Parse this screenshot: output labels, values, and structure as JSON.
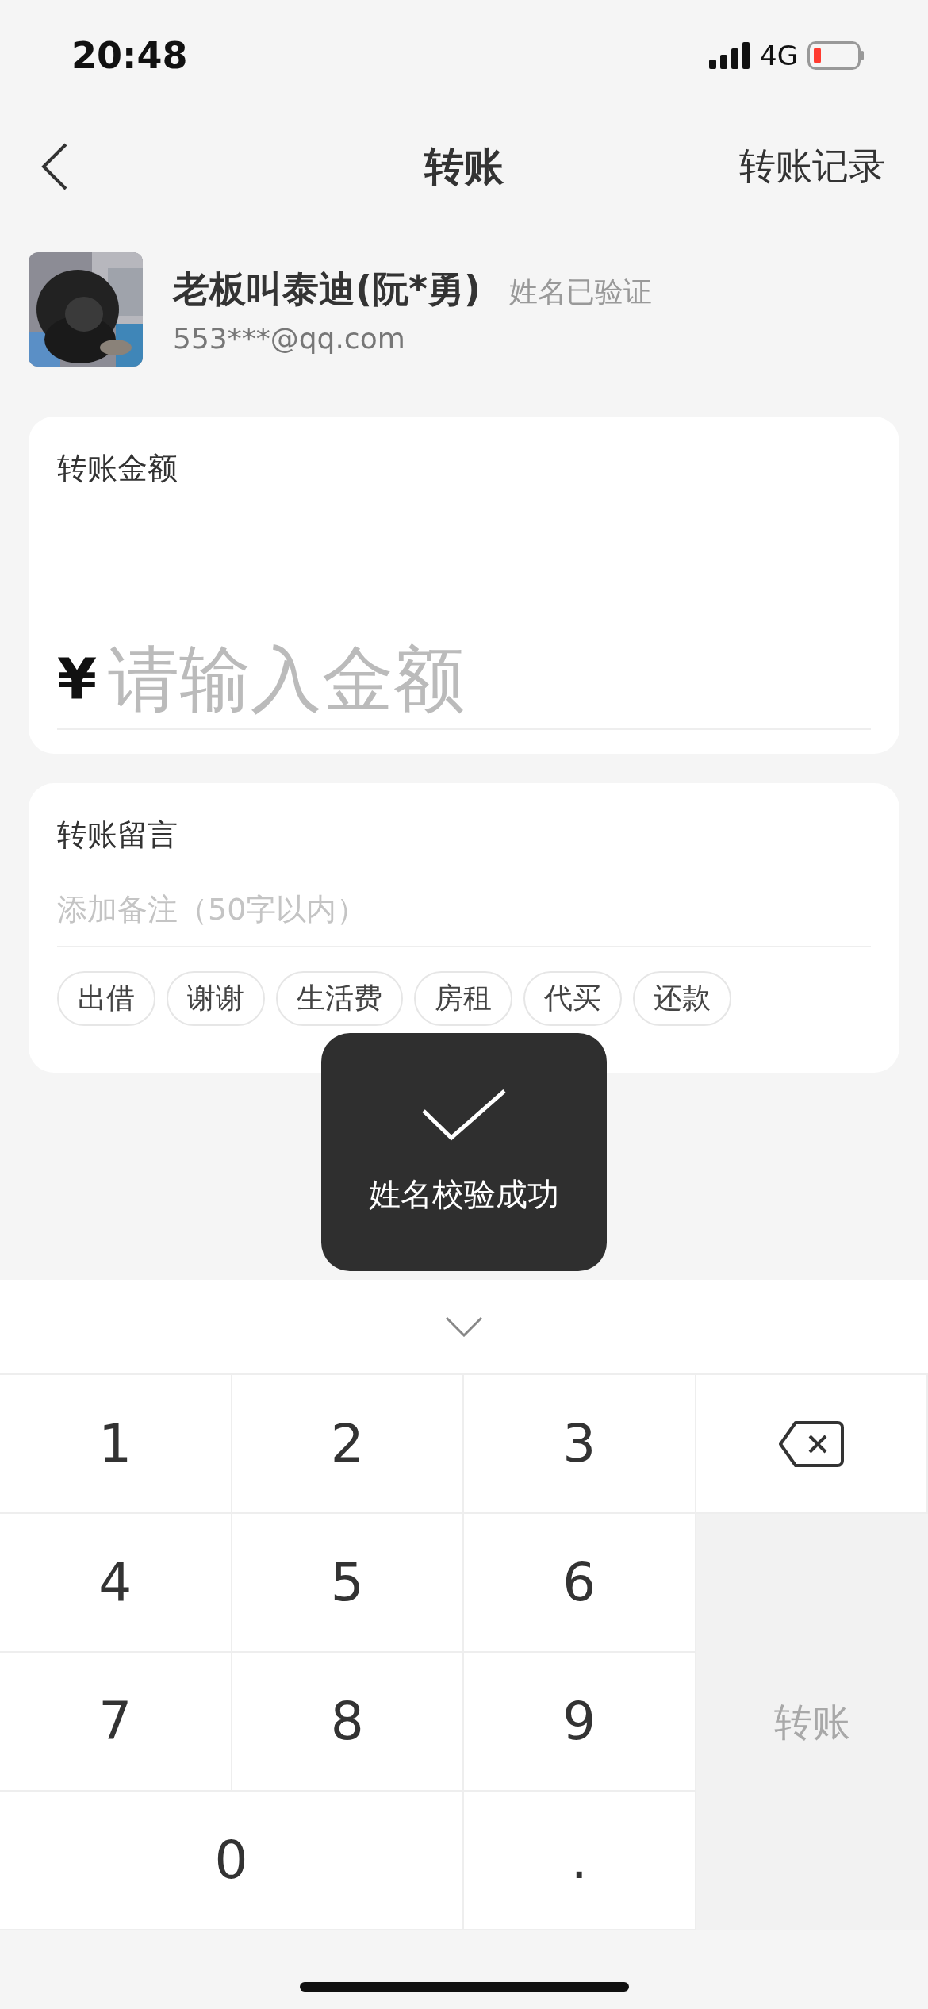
{
  "status_bar": {
    "time": "20:48",
    "network": "4G"
  },
  "nav": {
    "title": "转账",
    "right_action": "转账记录"
  },
  "recipient": {
    "name": "老板叫泰迪(阮*勇)",
    "verified_label": "姓名已验证",
    "account": "553***@qq.com"
  },
  "amount_card": {
    "label": "转账金额",
    "currency": "¥",
    "placeholder": "请输入金额"
  },
  "message_card": {
    "label": "转账留言",
    "placeholder": "添加备注（50字以内）",
    "chips": [
      "出借",
      "谢谢",
      "生活费",
      "房租",
      "代买",
      "还款"
    ]
  },
  "toast": {
    "text": "姓名校验成功"
  },
  "keypad": {
    "keys": [
      {
        "kind": "digit",
        "label": "1"
      },
      {
        "kind": "digit",
        "label": "2"
      },
      {
        "kind": "digit",
        "label": "3"
      },
      {
        "kind": "delete"
      },
      {
        "kind": "digit",
        "label": "4"
      },
      {
        "kind": "digit",
        "label": "5"
      },
      {
        "kind": "digit",
        "label": "6"
      },
      {
        "kind": "digit",
        "label": "7"
      },
      {
        "kind": "digit",
        "label": "8"
      },
      {
        "kind": "digit",
        "label": "9"
      },
      {
        "kind": "wide",
        "label": "0"
      },
      {
        "kind": "digit",
        "label": "."
      }
    ],
    "submit": {
      "label": "转账",
      "disabled": true
    }
  }
}
